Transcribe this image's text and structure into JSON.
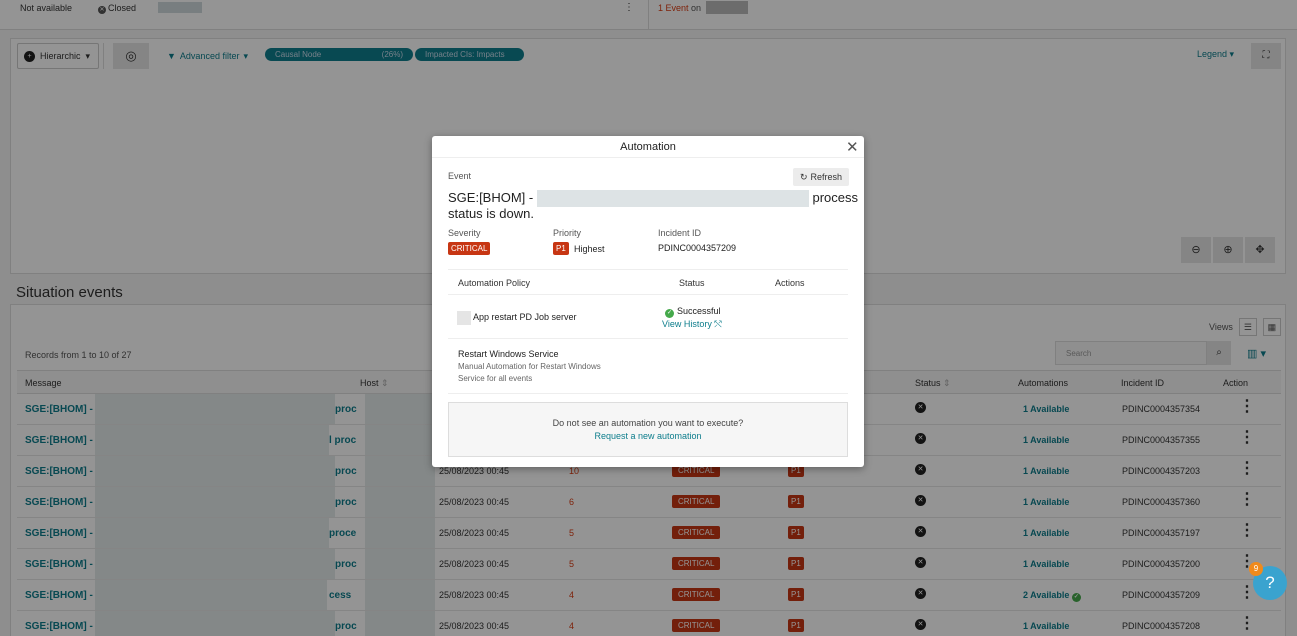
{
  "top_strip": {
    "not_available": "Not available",
    "closed": "Closed",
    "event_link": "1 Event",
    "event_on": "on"
  },
  "topology_toolbar": {
    "hierarchic": "Hierarchic",
    "advanced_filter": "Advanced filter",
    "pill_causal": "Causal Node",
    "pill_causal_pct": "(26%)",
    "pill_impacted": "Impacted CIs: Impacts",
    "legend": "Legend"
  },
  "situation": {
    "title": "Situation events",
    "records": "Records from 1 to 10 of 27",
    "views_label": "Views",
    "search_placeholder": "Search",
    "columns": [
      "Message",
      "Host",
      "Status",
      "Automations",
      "Incident ID",
      "Action"
    ],
    "rows": [
      {
        "msg": "SGE:[BHOM] -",
        "tail": "proc",
        "time": "",
        "count": "",
        "sev": "",
        "pri": "",
        "auto": "1 Available",
        "iid": "PDINC0004357354"
      },
      {
        "msg": "SGE:[BHOM] -",
        "tail": "l proc",
        "time": "",
        "count": "",
        "sev": "",
        "pri": "",
        "auto": "1 Available",
        "iid": "PDINC0004357355"
      },
      {
        "msg": "SGE:[BHOM] -",
        "tail": "proc",
        "time": "25/08/2023 00:45",
        "count": "10",
        "sev": "CRITICAL",
        "pri": "P1",
        "auto": "1 Available",
        "iid": "PDINC0004357203"
      },
      {
        "msg": "SGE:[BHOM] -",
        "tail": "proc",
        "time": "25/08/2023 00:45",
        "count": "6",
        "sev": "CRITICAL",
        "pri": "P1",
        "auto": "1 Available",
        "iid": "PDINC0004357360"
      },
      {
        "msg": "SGE:[BHOM] -",
        "tail": "proce",
        "time": "25/08/2023 00:45",
        "count": "5",
        "sev": "CRITICAL",
        "pri": "P1",
        "auto": "1 Available",
        "iid": "PDINC0004357197"
      },
      {
        "msg": "SGE:[BHOM] -",
        "tail": "proc",
        "time": "25/08/2023 00:45",
        "count": "5",
        "sev": "CRITICAL",
        "pri": "P1",
        "auto": "1 Available",
        "iid": "PDINC0004357200"
      },
      {
        "msg": "SGE:[BHOM] -",
        "tail": "cess",
        "time": "25/08/2023 00:45",
        "count": "4",
        "sev": "CRITICAL",
        "pri": "P1",
        "auto": "2 Available",
        "iid": "PDINC0004357209"
      },
      {
        "msg": "SGE:[BHOM] -",
        "tail": "proc",
        "time": "25/08/2023 00:45",
        "count": "4",
        "sev": "CRITICAL",
        "pri": "P1",
        "auto": "1 Available",
        "iid": "PDINC0004357208"
      }
    ]
  },
  "modal": {
    "title": "Automation",
    "event_label": "Event",
    "refresh": "Refresh",
    "event_prefix": "SGE:[BHOM] -",
    "event_suffix": "process",
    "event_line2": "status is down.",
    "severity_label": "Severity",
    "severity": "CRITICAL",
    "priority_label": "Priority",
    "priority_badge": "P1",
    "priority_text": "Highest",
    "incident_label": "Incident ID",
    "incident_id": "PDINC0004357209",
    "table_headers": {
      "policy": "Automation Policy",
      "status": "Status",
      "actions": "Actions"
    },
    "policy1": {
      "name": "App restart PD Job server",
      "status": "Successful",
      "history": "View History"
    },
    "policy2": {
      "name": "Restart Windows Service",
      "desc1": "Manual Automation for Restart Windows",
      "desc2": "Service for all events"
    },
    "request_q": "Do not see an automation you want to execute?",
    "request_link": "Request a new automation"
  },
  "help_badge": "9",
  "colors": {
    "accent": "#0d7d8c",
    "critical": "#c73613",
    "success": "#45a94b"
  }
}
